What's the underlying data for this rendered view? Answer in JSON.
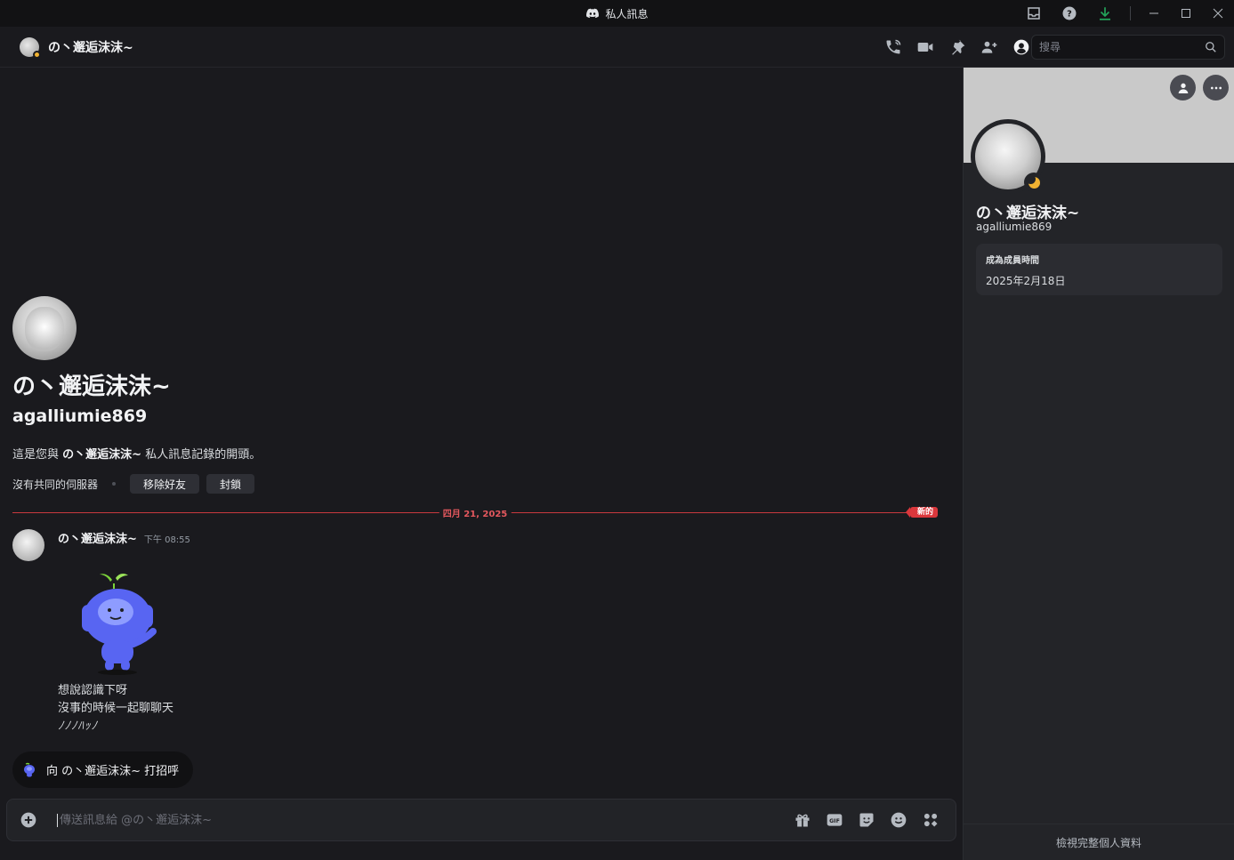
{
  "window": {
    "title": "私人訊息"
  },
  "header": {
    "name": "の丶邂逅沫沫~",
    "search_placeholder": "搜尋"
  },
  "intro": {
    "display_name": "の丶邂逅沫沫~",
    "username": "agalliumie869",
    "desc_prefix": "這是您與",
    "desc_name": "の丶邂逅沫沫~",
    "desc_suffix": "私人訊息記錄的開頭。",
    "no_servers": "沒有共同的伺服器",
    "remove_friend": "移除好友",
    "block": "封鎖"
  },
  "divider": {
    "date": "四月 21, 2025",
    "new_label": "新的"
  },
  "message": {
    "author": "の丶邂逅沫沫~",
    "time": "下午 08:55",
    "line1": "想說認識下呀",
    "line2": "沒事的時候一起聊聊天",
    "line3": "ﾉﾉﾉﾊｯﾉ"
  },
  "wave": {
    "label": "向 の丶邂逅沫沫~ 打招呼"
  },
  "composer": {
    "placeholder": "傳送訊息給 @の丶邂逅沫沫~"
  },
  "profile": {
    "display_name": "の丶邂逅沫沫~",
    "username": "agalliumie869",
    "member_since_label": "成為成員時間",
    "member_since": "2025年2月18日",
    "view_full": "檢視完整個人資料"
  },
  "colors": {
    "accent_red": "#da373c",
    "status_idle": "#f0b232",
    "download_green": "#23a55a",
    "wumpus_blue": "#5865f2"
  }
}
